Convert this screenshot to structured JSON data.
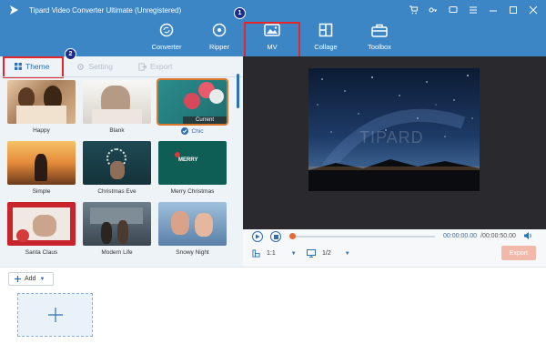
{
  "app": {
    "title": "Tipard Video Converter Ultimate (Unregistered)"
  },
  "nav": [
    {
      "label": "Converter",
      "icon": "converter-icon"
    },
    {
      "label": "Ripper",
      "icon": "ripper-icon"
    },
    {
      "label": "MV",
      "icon": "mv-icon"
    },
    {
      "label": "Collage",
      "icon": "collage-icon"
    },
    {
      "label": "Toolbox",
      "icon": "toolbox-icon"
    }
  ],
  "callouts": [
    "1",
    "2"
  ],
  "tabs": [
    {
      "label": "Theme",
      "state": "active"
    },
    {
      "label": "Setting",
      "state": "disabled"
    },
    {
      "label": "Export",
      "state": "disabled"
    }
  ],
  "themes": [
    {
      "label": "Happy"
    },
    {
      "label": "Blank"
    },
    {
      "label": "Chic",
      "tag": "Current",
      "selected": true
    },
    {
      "label": "Simple"
    },
    {
      "label": "Christmas Eve"
    },
    {
      "label": "Merry Christmas",
      "thumb_text": "MERRY"
    },
    {
      "label": "Santa Claus"
    },
    {
      "label": "Modern Life"
    },
    {
      "label": "Snowy Night"
    }
  ],
  "preview": {
    "watermark": "TIPARD"
  },
  "player": {
    "current_time": "00:00:00.00",
    "total_time": "/00:00:50.00",
    "ratio": "1:1",
    "screen": "1/2",
    "export_label": "Export"
  },
  "bottom": {
    "add_label": "Add"
  },
  "colors": {
    "accent": "#2c6fb3",
    "header": "#3d86c6",
    "highlight": "#e3262b",
    "export": "#f2b8aa"
  }
}
